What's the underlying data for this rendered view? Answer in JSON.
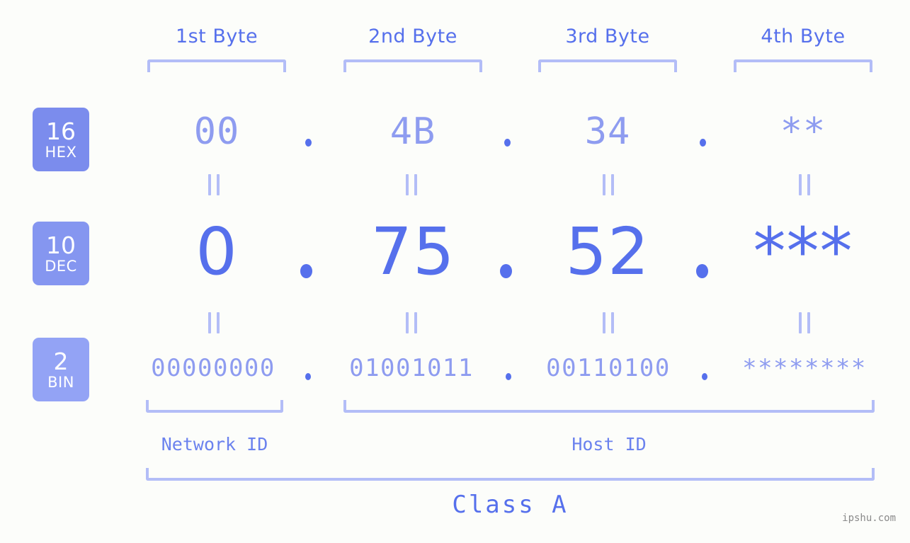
{
  "background_color": "#fcfdfa",
  "accent_color": "#5670ec",
  "light_accent_color": "#8e9cf0",
  "bracket_color": "#b3bdf7",
  "byte_headers": [
    {
      "label": "1st Byte"
    },
    {
      "label": "2nd Byte"
    },
    {
      "label": "3rd Byte"
    },
    {
      "label": "4th Byte"
    }
  ],
  "bases": [
    {
      "number": "16",
      "name": "HEX",
      "color": "#7b8ced"
    },
    {
      "number": "10",
      "name": "DEC",
      "color": "#8596f0"
    },
    {
      "number": "2",
      "name": "BIN",
      "color": "#93a3f5"
    }
  ],
  "rows": {
    "hex": {
      "values": [
        "00",
        "4B",
        "34",
        "**"
      ]
    },
    "dec": {
      "values": [
        "0",
        "75",
        "52",
        "***"
      ]
    },
    "bin": {
      "values": [
        "00000000",
        "01001011",
        "00110100",
        "********"
      ]
    }
  },
  "separator": ".",
  "equivalence_symbol": "‖",
  "segments": {
    "network_id": "Network ID",
    "host_id": "Host ID"
  },
  "class": {
    "label": "Class A"
  },
  "watermark": "ipshu.com"
}
